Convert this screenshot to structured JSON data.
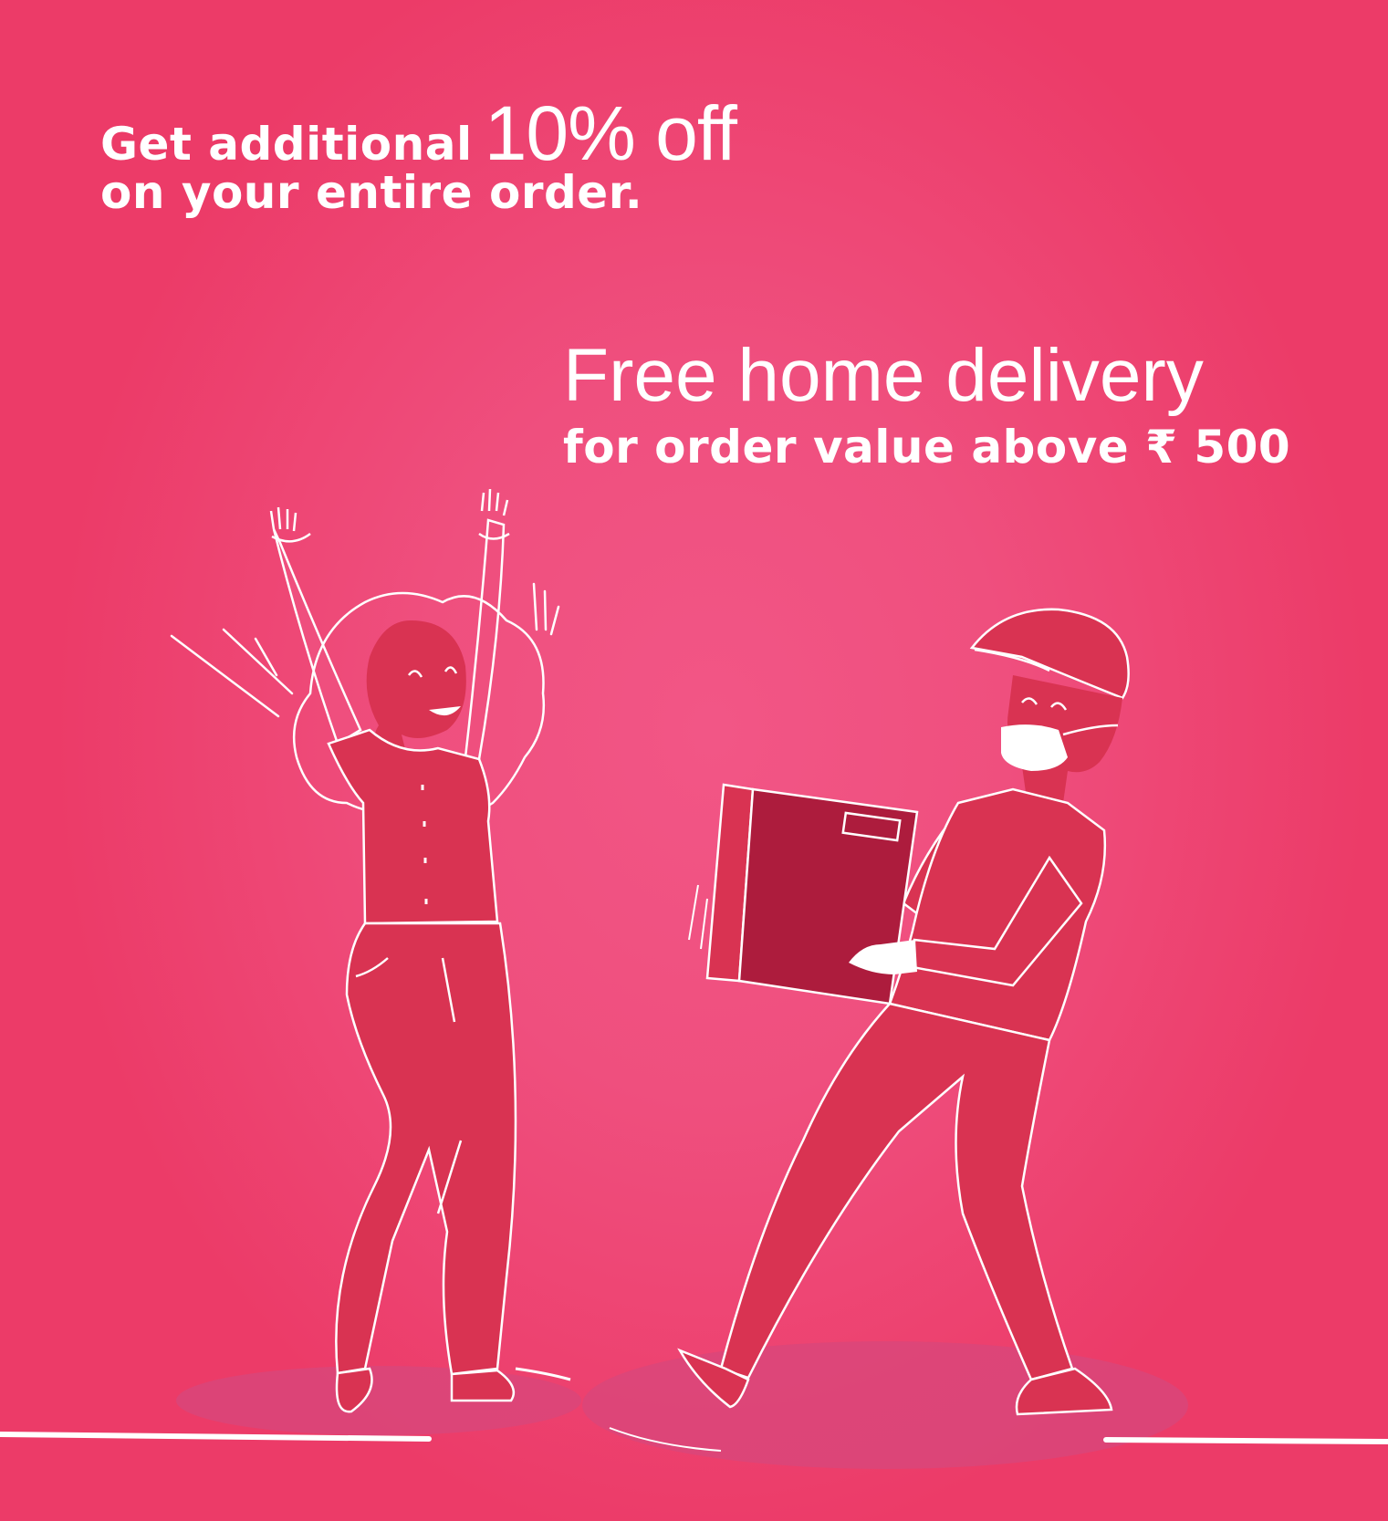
{
  "promo": {
    "line1_prefix": "Get additional",
    "line1_highlight": "10% off",
    "line2": "on your entire order."
  },
  "delivery": {
    "title": "Free home delivery",
    "subtitle": "for order value above ₹ 500"
  },
  "colors": {
    "background": "#ef4f7e",
    "figure_fill": "#d93352",
    "box_fill": "#ad1c3d",
    "outline": "#ffffff",
    "shadow": "#d9477a"
  }
}
